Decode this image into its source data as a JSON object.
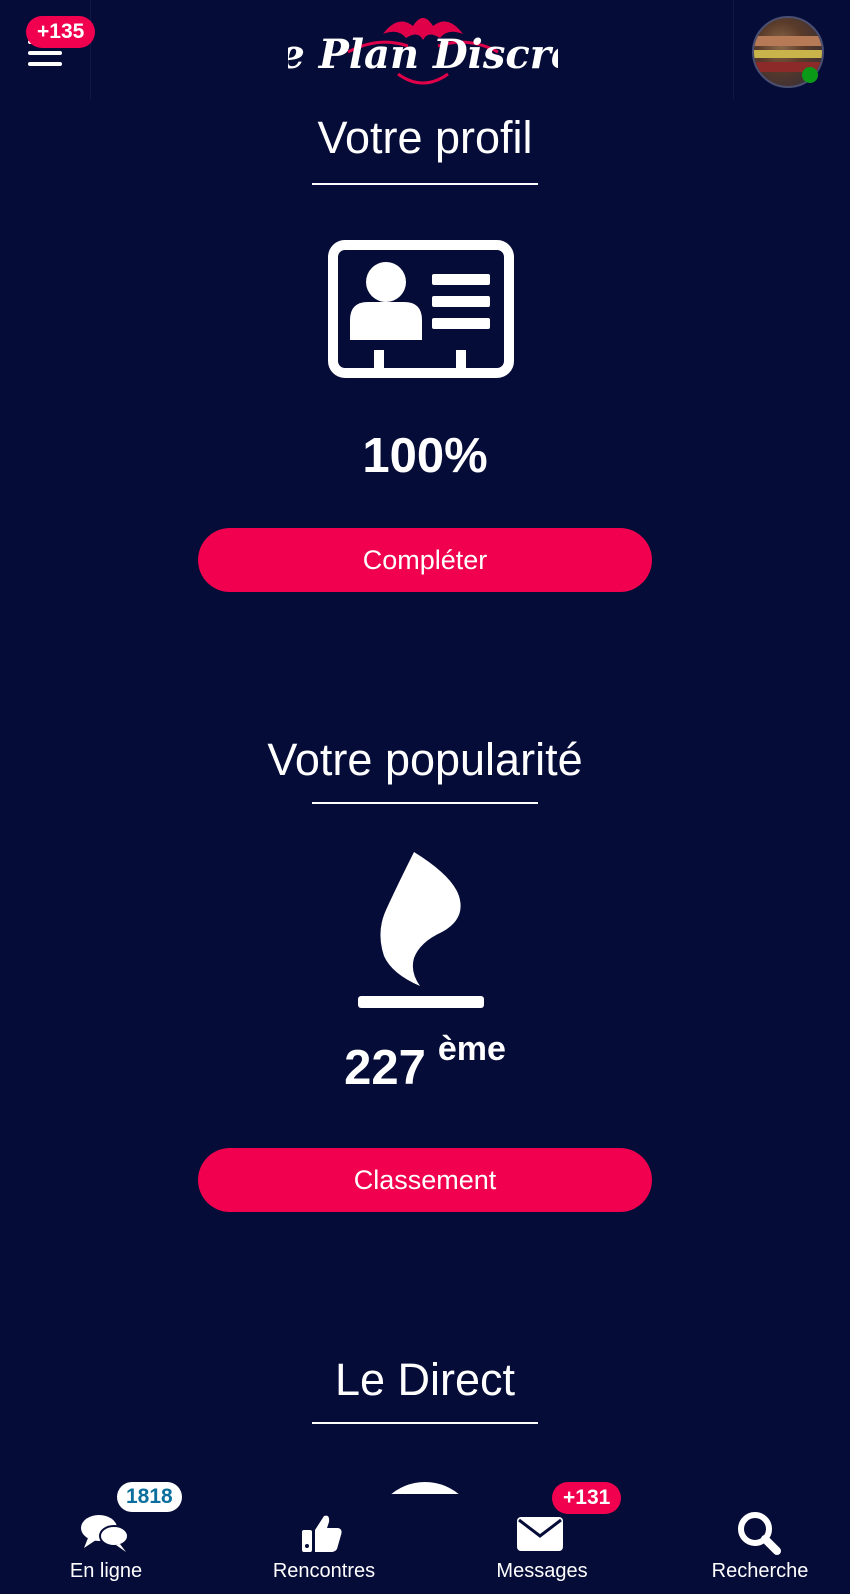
{
  "header": {
    "logo_text": "Le Plan Discret",
    "menu_badge": "+135",
    "icons": {
      "menu": "hamburger-menu-icon",
      "avatar": "user-avatar",
      "online": "online-status-dot"
    },
    "colors": {
      "background": "#060c38",
      "accent": "#f0004e",
      "online": "#0b9a17"
    }
  },
  "profile": {
    "title": "Votre profil",
    "icon": "id-card-icon",
    "completion": "100%",
    "button_label": "Compléter"
  },
  "popularity": {
    "title": "Votre popularité",
    "icon": "flame-icon",
    "rank": "227",
    "rank_suffix": "ème",
    "button_label": "Classement"
  },
  "live": {
    "title": "Le Direct"
  },
  "bottom_nav": {
    "items": [
      {
        "label": "En ligne",
        "badge": "1818",
        "icon": "chat-bubbles-icon"
      },
      {
        "label": "Rencontres",
        "badge": "",
        "icon": "thumbs-up-icon"
      },
      {
        "label": "Messages",
        "badge": "+131",
        "icon": "envelope-icon"
      },
      {
        "label": "Recherche",
        "badge": "",
        "icon": "search-icon"
      }
    ]
  }
}
